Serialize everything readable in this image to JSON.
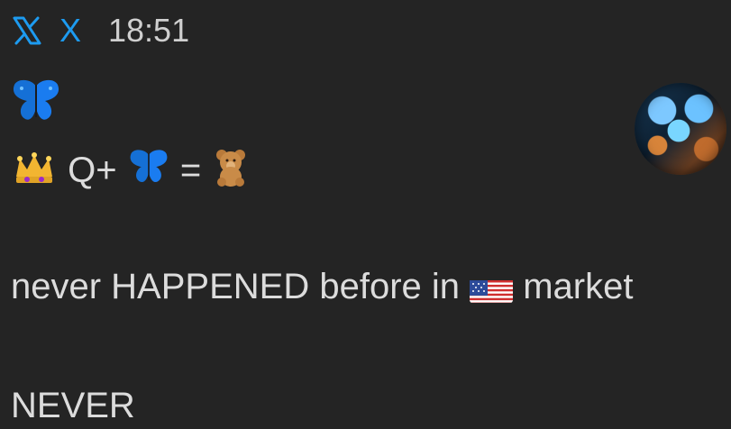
{
  "header": {
    "app_name": "X",
    "time": "18:51"
  },
  "content": {
    "line1_symbol": "butterfly-icon",
    "line2": {
      "left_icon": "crown-icon",
      "q_text": "Q+",
      "middle_icon": "butterfly-icon",
      "equals_text": "=",
      "right_icon": "teddy-bear-icon"
    },
    "line3_before": "never HAPPENED before in ",
    "line3_flag": "us-flag-icon",
    "line3_after": " market",
    "line4": "NEVER"
  },
  "colors": {
    "background": "#242424",
    "accent": "#1d9bf0",
    "text": "#dcdcdc"
  }
}
